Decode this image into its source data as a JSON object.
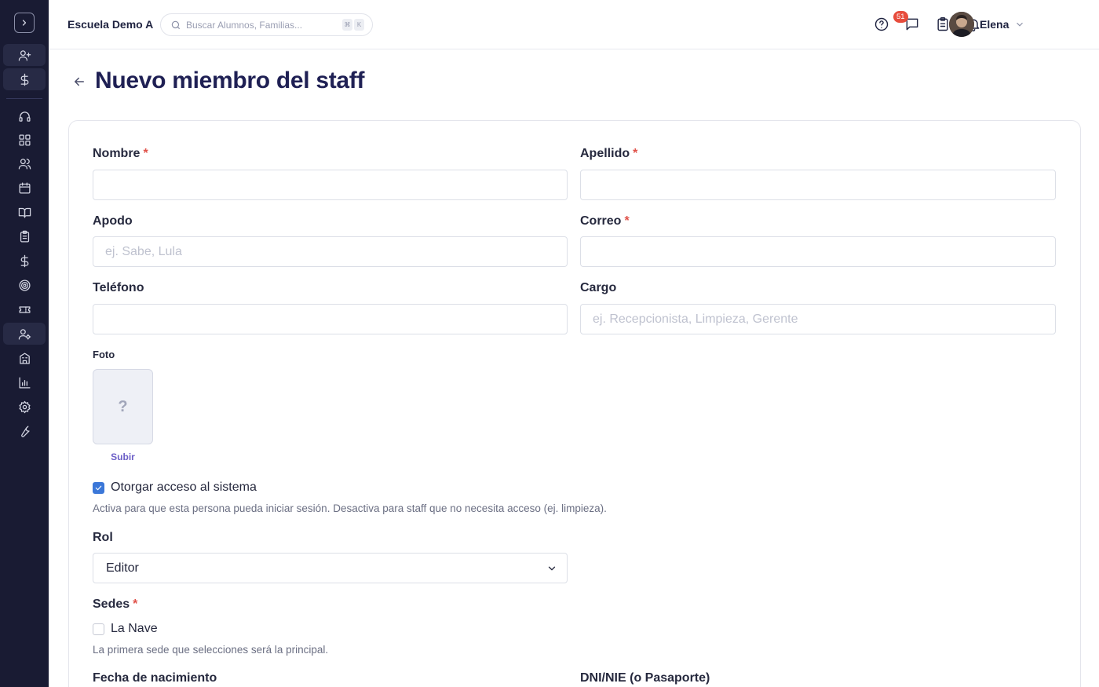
{
  "sidebar": {
    "toggle_icon": "chevron-right-icon",
    "items": [
      {
        "name": "add-user",
        "icon": "user-plus-icon"
      },
      {
        "name": "billing-quick",
        "icon": "dollar-icon"
      },
      {
        "name": "support",
        "icon": "headset-icon"
      },
      {
        "name": "dashboard",
        "icon": "grid-icon"
      },
      {
        "name": "students",
        "icon": "users-icon"
      },
      {
        "name": "calendar",
        "icon": "calendar-icon"
      },
      {
        "name": "courses",
        "icon": "book-icon"
      },
      {
        "name": "tasks",
        "icon": "clipboard-icon"
      },
      {
        "name": "payments",
        "icon": "dollar-icon"
      },
      {
        "name": "goals",
        "icon": "target-icon"
      },
      {
        "name": "tickets",
        "icon": "ticket-icon"
      },
      {
        "name": "staff",
        "icon": "user-cog-icon",
        "active": true
      },
      {
        "name": "buildings",
        "icon": "building-icon"
      },
      {
        "name": "reports",
        "icon": "bar-chart-icon"
      },
      {
        "name": "settings",
        "icon": "gear-icon"
      },
      {
        "name": "tools",
        "icon": "wrench-icon"
      }
    ]
  },
  "header": {
    "school_name": "Escuela Demo A",
    "search_placeholder": "Buscar Alumnos, Familias...",
    "search_shortcut": [
      "⌘",
      "K"
    ],
    "tasks_badge": "51",
    "user_name": "Elena"
  },
  "page": {
    "title": "Nuevo miembro del staff"
  },
  "form": {
    "first_name": {
      "label": "Nombre",
      "required": "*",
      "value": "",
      "placeholder": ""
    },
    "last_name": {
      "label": "Apellido",
      "required": "*",
      "value": "",
      "placeholder": ""
    },
    "nickname": {
      "label": "Apodo",
      "value": "",
      "placeholder": "ej. Sabe, Lula"
    },
    "email": {
      "label": "Correo",
      "required": "*",
      "value": "",
      "placeholder": ""
    },
    "phone": {
      "label": "Teléfono",
      "value": "",
      "placeholder": ""
    },
    "position": {
      "label": "Cargo",
      "value": "",
      "placeholder": "ej. Recepcionista, Limpieza, Gerente"
    },
    "photo": {
      "label": "Foto",
      "placeholder_glyph": "?",
      "upload_label": "Subir"
    },
    "system_access": {
      "label": "Otorgar acceso al sistema",
      "checked": true,
      "hint": "Activa para que esta persona pueda iniciar sesión. Desactiva para staff que no necesita acceso (ej. limpieza)."
    },
    "role": {
      "label": "Rol",
      "selected": "Editor"
    },
    "locations": {
      "label": "Sedes",
      "required": "*",
      "options": [
        {
          "label": "La Nave",
          "checked": false
        }
      ],
      "hint": "La primera sede que selecciones será la principal."
    },
    "birth_date": {
      "label": "Fecha de nacimiento"
    },
    "id_document": {
      "label": "DNI/NIE (o Pasaporte)"
    }
  },
  "colors": {
    "sidebar_bg": "#191b33",
    "title": "#1f2054",
    "required": "#e0524a",
    "accent_link": "#6c5fc7",
    "checkbox": "#3b77d8",
    "badge": "#e74c3c"
  }
}
